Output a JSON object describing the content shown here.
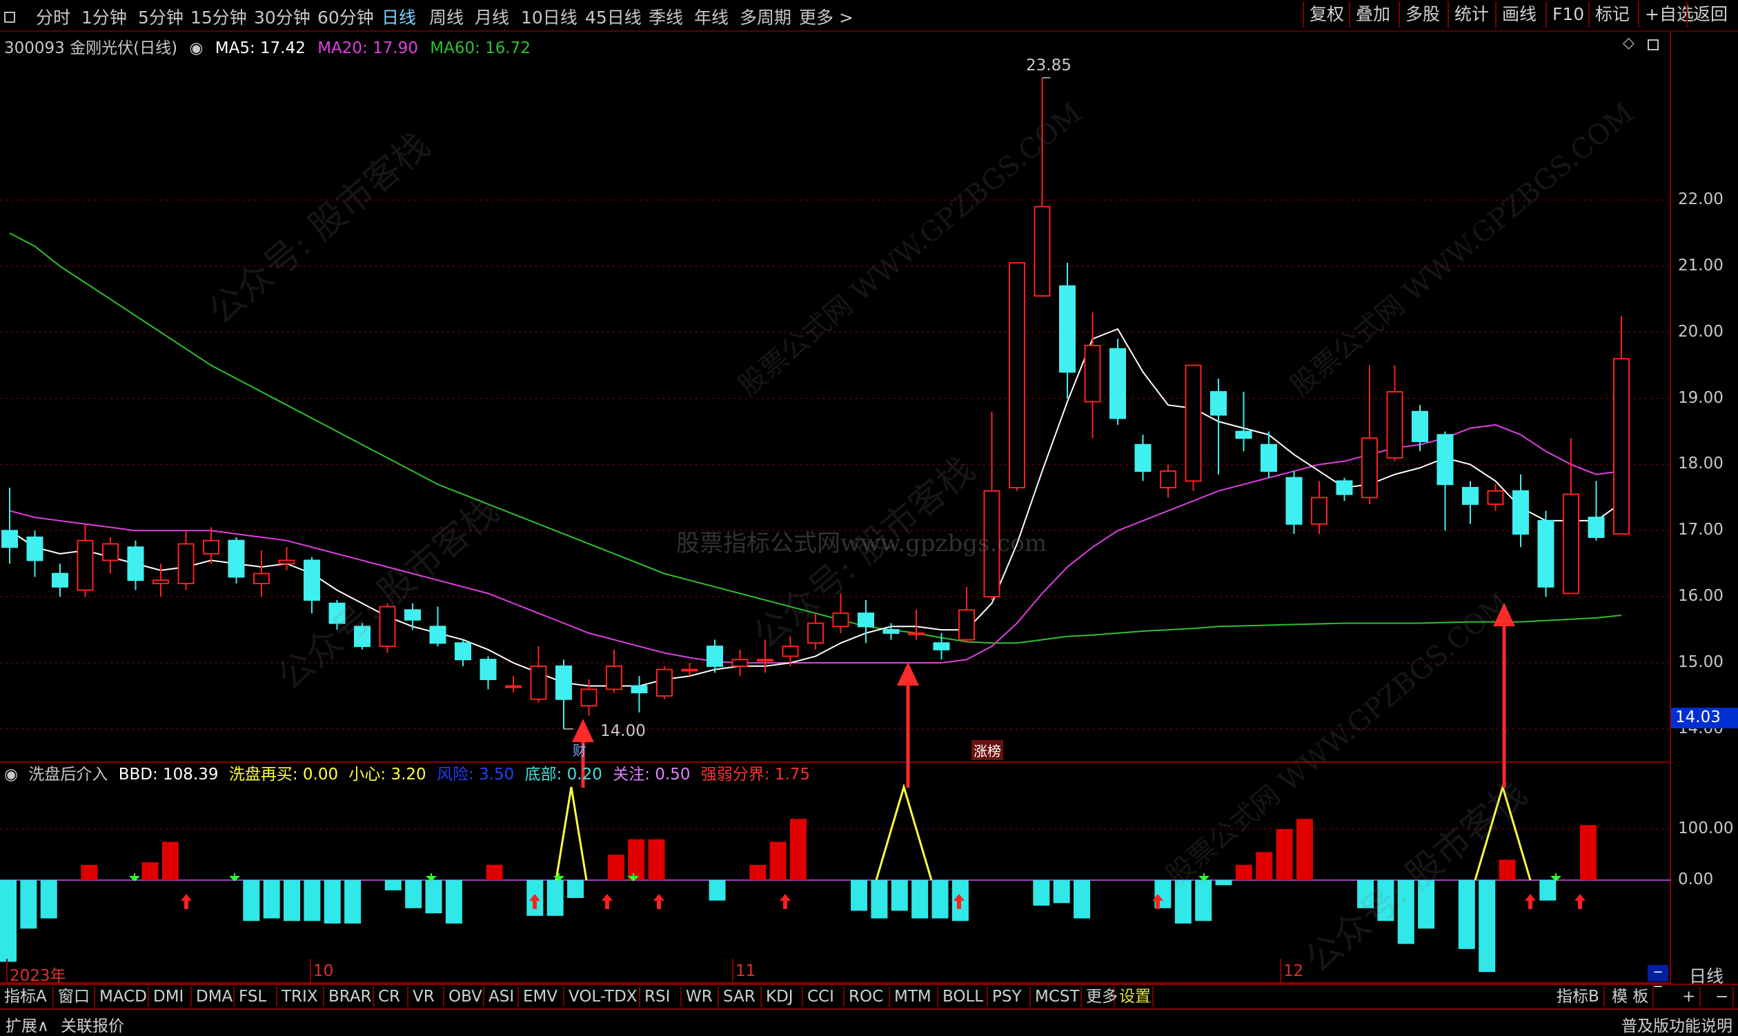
{
  "toolbar": {
    "periods": [
      "分时",
      "1分钟",
      "5分钟",
      "15分钟",
      "30分钟",
      "60分钟",
      "日线",
      "周线",
      "月线",
      "10日线",
      "45日线",
      "季线",
      "年线",
      "多周期",
      "更多 >"
    ],
    "active_period": "日线",
    "right_buttons": [
      "复权",
      "叠加",
      "多股",
      "统计",
      "画线",
      "F10",
      "标记",
      "+自选",
      "返回"
    ]
  },
  "stock": {
    "title": "300093 金刚光伏(日线)",
    "ma5_label": "MA5: 17.42",
    "ma20_label": "MA20: 17.90",
    "ma60_label": "MA60: 16.72",
    "high_label": "23.85",
    "low_label": "14.00",
    "current_price": "14.03",
    "marker_cai": "财",
    "marker_zhangbang": "涨榜"
  },
  "indicator": {
    "name": "洗盘后介入",
    "bbd": "BBD: 108.39",
    "xipan": "洗盘再买: 0.00",
    "xiaoxin": "小心: 3.20",
    "fengxian": "风险: 3.50",
    "dibu": "底部: 0.20",
    "guanzhu": "关注: 0.50",
    "qiangruo": "强弱分界: 1.75"
  },
  "price_axis": [
    "22.00",
    "21.00",
    "20.00",
    "19.00",
    "18.00",
    "17.00",
    "16.00",
    "15.00",
    "14.00"
  ],
  "ind_axis": [
    "100.00",
    "0.00"
  ],
  "dates": [
    "2023年",
    "10",
    "11",
    "12"
  ],
  "bottom_tabs": [
    "指标A",
    "窗口",
    "MACD",
    "DMI",
    "DMA",
    "FSL",
    "TRIX",
    "BRAR",
    "CR",
    "VR",
    "OBV",
    "ASI",
    "EMV",
    "VOL-TDX",
    "RSI",
    "WR",
    "SAR",
    "KDJ",
    "CCI",
    "ROC",
    "MTM",
    "BOLL",
    "PSY",
    "MCST",
    "更多",
    "设置"
  ],
  "bottom_right": [
    "指标B",
    "模 板",
    "+",
    "−"
  ],
  "daily_label": "日线",
  "status": {
    "left1": "扩展∧",
    "left2": "关联报价",
    "right": "普及版功能说明"
  },
  "watermarks": [
    "公众号: 股市客栈",
    "股票公式网 WWW.GPZBGS.COM",
    "股票指标公式网www.gpzbgs.com"
  ],
  "colors": {
    "up": "#ff2020",
    "down": "#40f0f0",
    "ma5": "#ffffff",
    "ma20": "#e040e0",
    "ma60": "#30c030",
    "arrow": "#ff2a2a",
    "signal": "#ffff40"
  },
  "chart_data": {
    "type": "candlestick",
    "candles": [
      {
        "o": 17.0,
        "c": 16.75,
        "h": 17.65,
        "l": 16.5
      },
      {
        "o": 16.9,
        "c": 16.55,
        "h": 17.0,
        "l": 16.3
      },
      {
        "o": 16.35,
        "c": 16.15,
        "h": 16.5,
        "l": 16.0
      },
      {
        "o": 16.1,
        "c": 16.85,
        "h": 17.1,
        "l": 16.0
      },
      {
        "o": 16.55,
        "c": 16.8,
        "h": 16.9,
        "l": 16.35
      },
      {
        "o": 16.75,
        "c": 16.25,
        "h": 16.85,
        "l": 16.1
      },
      {
        "o": 16.2,
        "c": 16.25,
        "h": 16.5,
        "l": 16.0
      },
      {
        "o": 16.2,
        "c": 16.8,
        "h": 17.0,
        "l": 16.1
      },
      {
        "o": 16.65,
        "c": 16.85,
        "h": 17.05,
        "l": 16.5
      },
      {
        "o": 16.85,
        "c": 16.3,
        "h": 16.9,
        "l": 16.2
      },
      {
        "o": 16.2,
        "c": 16.35,
        "h": 16.7,
        "l": 16.0
      },
      {
        "o": 16.5,
        "c": 16.55,
        "h": 16.75,
        "l": 16.4
      },
      {
        "o": 16.55,
        "c": 15.95,
        "h": 16.6,
        "l": 15.75
      },
      {
        "o": 15.9,
        "c": 15.6,
        "h": 15.95,
        "l": 15.5
      },
      {
        "o": 15.55,
        "c": 15.25,
        "h": 15.6,
        "l": 15.2
      },
      {
        "o": 15.25,
        "c": 15.85,
        "h": 15.9,
        "l": 15.15
      },
      {
        "o": 15.8,
        "c": 15.65,
        "h": 15.9,
        "l": 15.5
      },
      {
        "o": 15.55,
        "c": 15.3,
        "h": 15.85,
        "l": 15.25
      },
      {
        "o": 15.3,
        "c": 15.05,
        "h": 15.35,
        "l": 14.95
      },
      {
        "o": 15.05,
        "c": 14.75,
        "h": 15.1,
        "l": 14.6
      },
      {
        "o": 14.65,
        "c": 14.65,
        "h": 14.8,
        "l": 14.55
      },
      {
        "o": 14.45,
        "c": 14.95,
        "h": 15.25,
        "l": 14.4
      },
      {
        "o": 14.95,
        "c": 14.45,
        "h": 15.05,
        "l": 14.0
      },
      {
        "o": 14.35,
        "c": 14.6,
        "h": 14.75,
        "l": 14.2
      },
      {
        "o": 14.6,
        "c": 14.95,
        "h": 15.2,
        "l": 14.55
      },
      {
        "o": 14.65,
        "c": 14.55,
        "h": 14.8,
        "l": 14.25
      },
      {
        "o": 14.5,
        "c": 14.9,
        "h": 14.95,
        "l": 14.45
      },
      {
        "o": 14.9,
        "c": 14.9,
        "h": 15.0,
        "l": 14.8
      },
      {
        "o": 15.25,
        "c": 14.95,
        "h": 15.35,
        "l": 14.85
      },
      {
        "o": 14.95,
        "c": 15.05,
        "h": 15.2,
        "l": 14.8
      },
      {
        "o": 15.05,
        "c": 15.05,
        "h": 15.35,
        "l": 14.85
      },
      {
        "o": 15.1,
        "c": 15.25,
        "h": 15.4,
        "l": 14.95
      },
      {
        "o": 15.3,
        "c": 15.6,
        "h": 15.75,
        "l": 15.2
      },
      {
        "o": 15.55,
        "c": 15.75,
        "h": 16.05,
        "l": 15.45
      },
      {
        "o": 15.75,
        "c": 15.55,
        "h": 15.95,
        "l": 15.3
      },
      {
        "o": 15.5,
        "c": 15.45,
        "h": 15.6,
        "l": 15.35
      },
      {
        "o": 15.45,
        "c": 15.45,
        "h": 15.8,
        "l": 15.35
      },
      {
        "o": 15.3,
        "c": 15.2,
        "h": 15.45,
        "l": 15.05
      },
      {
        "o": 15.35,
        "c": 15.8,
        "h": 16.15,
        "l": 15.3
      },
      {
        "o": 16.0,
        "c": 17.6,
        "h": 18.8,
        "l": 15.95
      },
      {
        "o": 17.65,
        "c": 21.05,
        "h": 21.05,
        "l": 17.6
      },
      {
        "o": 20.55,
        "c": 21.9,
        "h": 23.85,
        "l": 20.85
      },
      {
        "o": 20.7,
        "c": 19.4,
        "h": 21.05,
        "l": 19.0
      },
      {
        "o": 18.95,
        "c": 19.8,
        "h": 20.3,
        "l": 18.4
      },
      {
        "o": 19.75,
        "c": 18.7,
        "h": 19.9,
        "l": 18.6
      },
      {
        "o": 18.3,
        "c": 17.9,
        "h": 18.45,
        "l": 17.75
      },
      {
        "o": 17.65,
        "c": 17.9,
        "h": 18.0,
        "l": 17.5
      },
      {
        "o": 17.75,
        "c": 19.5,
        "h": 19.5,
        "l": 17.6
      },
      {
        "o": 19.1,
        "c": 18.75,
        "h": 19.3,
        "l": 17.85
      },
      {
        "o": 18.5,
        "c": 18.4,
        "h": 19.1,
        "l": 18.2
      },
      {
        "o": 18.3,
        "c": 17.9,
        "h": 18.5,
        "l": 17.8
      },
      {
        "o": 17.8,
        "c": 17.1,
        "h": 17.9,
        "l": 16.95
      },
      {
        "o": 17.1,
        "c": 17.5,
        "h": 17.75,
        "l": 16.95
      },
      {
        "o": 17.75,
        "c": 17.55,
        "h": 17.8,
        "l": 17.45
      },
      {
        "o": 17.5,
        "c": 18.4,
        "h": 19.5,
        "l": 17.4
      },
      {
        "o": 18.1,
        "c": 19.1,
        "h": 19.5,
        "l": 18.05
      },
      {
        "o": 18.8,
        "c": 18.35,
        "h": 18.9,
        "l": 18.2
      },
      {
        "o": 18.45,
        "c": 17.7,
        "h": 18.5,
        "l": 17.0
      },
      {
        "o": 17.65,
        "c": 17.4,
        "h": 17.75,
        "l": 17.1
      },
      {
        "o": 17.4,
        "c": 17.6,
        "h": 17.7,
        "l": 17.3
      },
      {
        "o": 17.6,
        "c": 16.95,
        "h": 17.85,
        "l": 16.75
      },
      {
        "o": 17.15,
        "c": 16.15,
        "h": 17.3,
        "l": 16.0
      },
      {
        "o": 16.05,
        "c": 17.55,
        "h": 18.4,
        "l": 16.05
      },
      {
        "o": 17.2,
        "c": 16.9,
        "h": 17.75,
        "l": 16.85
      },
      {
        "o": 16.95,
        "c": 19.6,
        "h": 20.25,
        "l": 16.95
      }
    ],
    "ma5": [
      17.0,
      16.75,
      16.65,
      16.7,
      16.6,
      16.5,
      16.4,
      16.45,
      16.55,
      16.5,
      16.45,
      16.5,
      16.35,
      16.1,
      15.9,
      15.7,
      15.55,
      15.45,
      15.35,
      15.2,
      15.0,
      14.85,
      14.7,
      14.65,
      14.65,
      14.65,
      14.75,
      14.8,
      14.9,
      14.95,
      14.95,
      15.0,
      15.1,
      15.3,
      15.45,
      15.55,
      15.55,
      15.5,
      15.5,
      15.9,
      16.8,
      17.9,
      18.95,
      19.9,
      20.05,
      19.4,
      18.9,
      18.85,
      18.65,
      18.55,
      18.45,
      18.15,
      17.9,
      17.65,
      17.7,
      17.85,
      17.95,
      18.1,
      18.0,
      17.75,
      17.35,
      17.15,
      17.15,
      17.15,
      17.42
    ],
    "ma20": [
      17.3,
      17.2,
      17.15,
      17.1,
      17.05,
      17.0,
      17.0,
      17.0,
      17.0,
      16.95,
      16.9,
      16.85,
      16.75,
      16.65,
      16.55,
      16.45,
      16.35,
      16.25,
      16.15,
      16.05,
      15.9,
      15.75,
      15.6,
      15.45,
      15.35,
      15.25,
      15.15,
      15.08,
      15.02,
      15.0,
      15.0,
      15.0,
      15.0,
      15.0,
      15.0,
      15.0,
      15.0,
      15.0,
      15.05,
      15.25,
      15.6,
      16.05,
      16.45,
      16.75,
      17.0,
      17.15,
      17.3,
      17.45,
      17.6,
      17.7,
      17.8,
      17.9,
      18.0,
      18.05,
      18.15,
      18.25,
      18.3,
      18.4,
      18.55,
      18.6,
      18.45,
      18.2,
      18.0,
      17.85,
      17.9
    ],
    "ma60": [
      21.5,
      21.3,
      21.0,
      20.75,
      20.5,
      20.25,
      20.0,
      19.75,
      19.5,
      19.3,
      19.1,
      18.9,
      18.7,
      18.5,
      18.3,
      18.1,
      17.9,
      17.7,
      17.55,
      17.4,
      17.25,
      17.1,
      16.95,
      16.8,
      16.65,
      16.5,
      16.35,
      16.25,
      16.15,
      16.05,
      15.95,
      15.85,
      15.75,
      15.65,
      15.55,
      15.5,
      15.45,
      15.38,
      15.32,
      15.3,
      15.3,
      15.35,
      15.4,
      15.42,
      15.45,
      15.48,
      15.5,
      15.52,
      15.55,
      15.56,
      15.57,
      15.58,
      15.59,
      15.6,
      15.6,
      15.6,
      15.6,
      15.61,
      15.62,
      15.62,
      15.62,
      15.64,
      15.66,
      15.68,
      15.72
    ],
    "bbd": [
      -160,
      -95,
      -75,
      0,
      30,
      0,
      0,
      35,
      75,
      0,
      0,
      0,
      -80,
      -75,
      -80,
      -80,
      -85,
      -85,
      0,
      -20,
      -55,
      -65,
      -85,
      0,
      30,
      0,
      -70,
      -70,
      -35,
      0,
      50,
      80,
      80,
      0,
      0,
      -40,
      0,
      30,
      75,
      120,
      0,
      0,
      -60,
      -75,
      -60,
      -75,
      -75,
      -80,
      0,
      0,
      0,
      -50,
      -45,
      -75,
      0,
      0,
      0,
      -55,
      -85,
      -80,
      -10,
      30,
      55,
      100,
      120,
      0,
      0,
      -55,
      -80,
      -125,
      -95,
      0,
      -135,
      -180,
      40,
      0,
      -40,
      0,
      108
    ],
    "ylim": [
      13.55,
      24.4
    ]
  }
}
